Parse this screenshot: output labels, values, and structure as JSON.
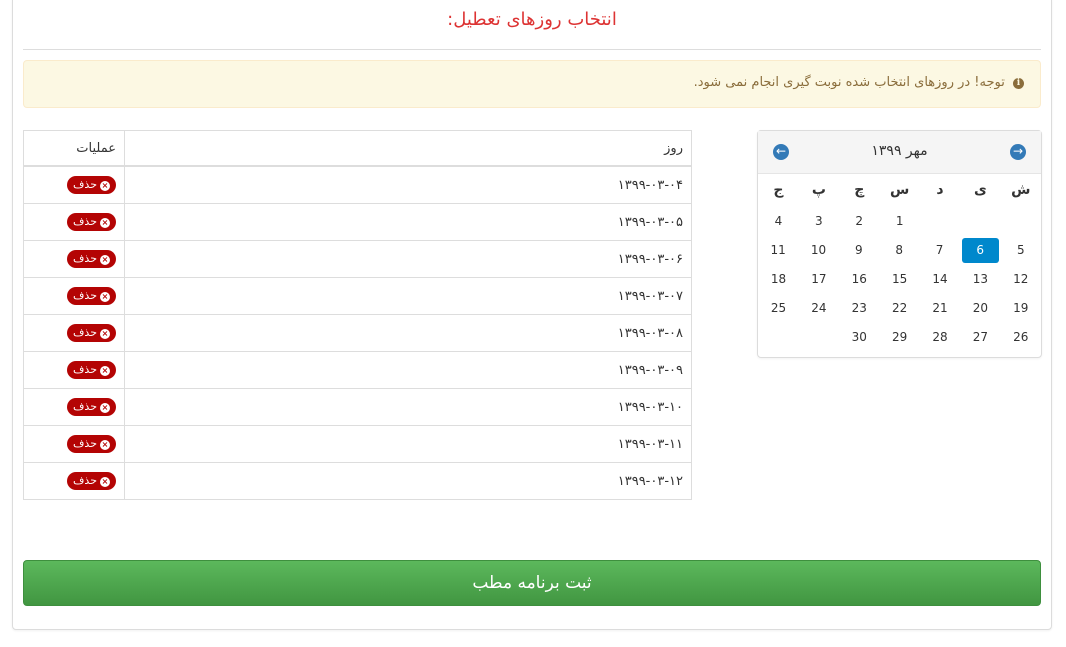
{
  "title": "انتخاب روزهای تعطیل:",
  "alert": {
    "icon": "info-circle-icon",
    "text": "توجه! در روزهای انتخاب شده نوبت گیری انجام نمی شود."
  },
  "table": {
    "headers": {
      "day": "روز",
      "ops": "عملیات"
    },
    "delete_label": "حذف",
    "rows": [
      "۱۳۹۹-۰۳-۰۴",
      "۱۳۹۹-۰۳-۰۵",
      "۱۳۹۹-۰۳-۰۶",
      "۱۳۹۹-۰۳-۰۷",
      "۱۳۹۹-۰۳-۰۸",
      "۱۳۹۹-۰۳-۰۹",
      "۱۳۹۹-۰۳-۱۰",
      "۱۳۹۹-۰۳-۱۱",
      "۱۳۹۹-۰۳-۱۲"
    ]
  },
  "calendar": {
    "title": "مهر ۱۳۹۹",
    "weekdays": [
      "ش",
      "ی",
      "د",
      "س",
      "چ",
      "پ",
      "ج"
    ],
    "weeks": [
      [
        "",
        "",
        "",
        "1",
        "2",
        "3",
        "4"
      ],
      [
        "5",
        "6",
        "7",
        "8",
        "9",
        "10",
        "11"
      ],
      [
        "12",
        "13",
        "14",
        "15",
        "16",
        "17",
        "18"
      ],
      [
        "19",
        "20",
        "21",
        "22",
        "23",
        "24",
        "25"
      ],
      [
        "26",
        "27",
        "28",
        "29",
        "30",
        "",
        ""
      ]
    ],
    "selected": "6",
    "selected_color": "#0088cc"
  },
  "submit_label": "ثبت برنامه مطب"
}
